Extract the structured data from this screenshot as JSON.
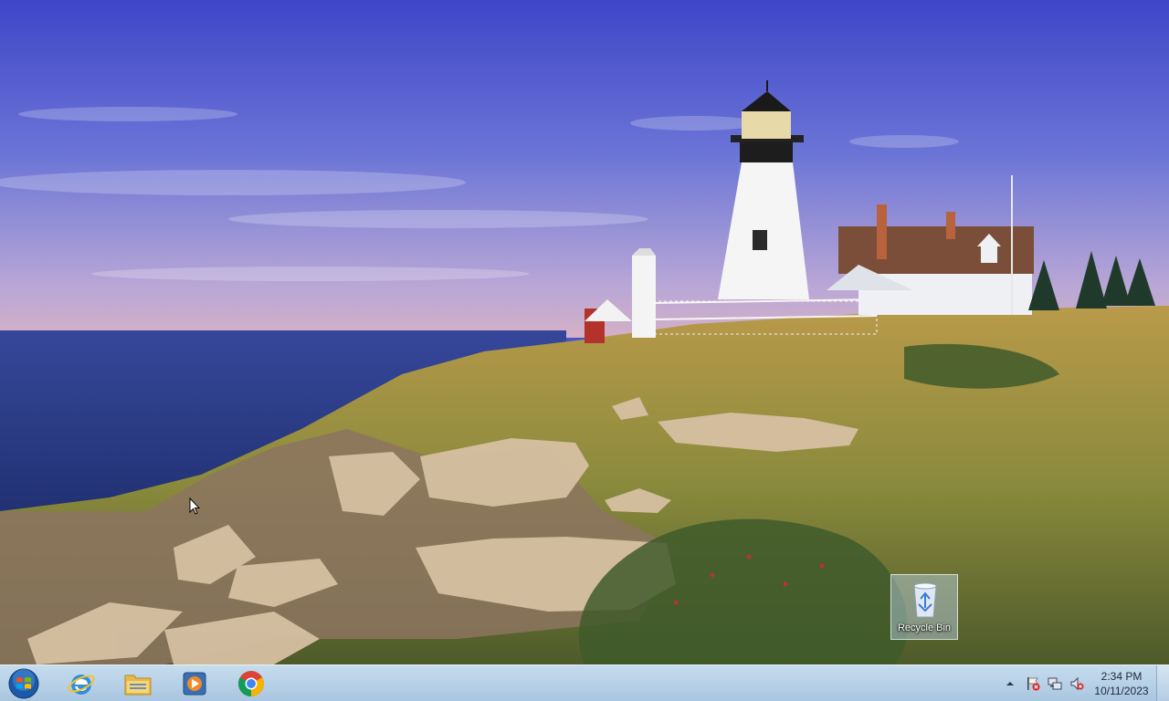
{
  "desktop": {
    "wallpaper": "lighthouse-coast-wallpaper",
    "icons": [
      {
        "name": "recycle-bin-icon",
        "label": "Recycle Bin"
      }
    ]
  },
  "taskbar": {
    "start_icon": "windows-start-orb-icon",
    "pinned": [
      "internet-explorer-icon",
      "file-explorer-icon",
      "media-player-icon",
      "chrome-icon"
    ],
    "tray_icons": [
      "show-hidden-icons-chevron",
      "action-center-flag-icon",
      "network-icon",
      "volume-muted-icon"
    ],
    "clock": {
      "time": "2:34 PM",
      "date": "10/11/2023"
    }
  },
  "colors": {
    "taskbar": "#b8d2e8",
    "sky": "#4a55c8",
    "sea": "#2a3f86"
  }
}
